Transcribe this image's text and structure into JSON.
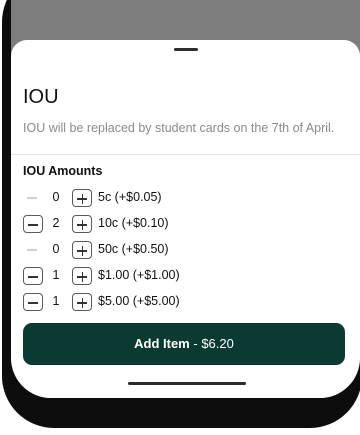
{
  "sheet": {
    "title": "IOU",
    "description": "IOU will be replaced by student cards on the 7th of April."
  },
  "amounts": {
    "title": "IOU Amounts",
    "rows": [
      {
        "qty": "0",
        "label": "5c (+$0.05)",
        "minus_enabled": false
      },
      {
        "qty": "2",
        "label": "10c (+$0.10)",
        "minus_enabled": true
      },
      {
        "qty": "0",
        "label": "50c (+$0.50)",
        "minus_enabled": false
      },
      {
        "qty": "1",
        "label": "$1.00 (+$1.00)",
        "minus_enabled": true
      },
      {
        "qty": "1",
        "label": "$5.00 (+$5.00)",
        "minus_enabled": true
      }
    ]
  },
  "add_button": {
    "label": "Add Item",
    "separator": " - ",
    "total": "$6.20"
  },
  "colors": {
    "primary": "#0b3a33",
    "backdrop": "#7d7d7d",
    "muted_text": "#8a8a8a"
  }
}
